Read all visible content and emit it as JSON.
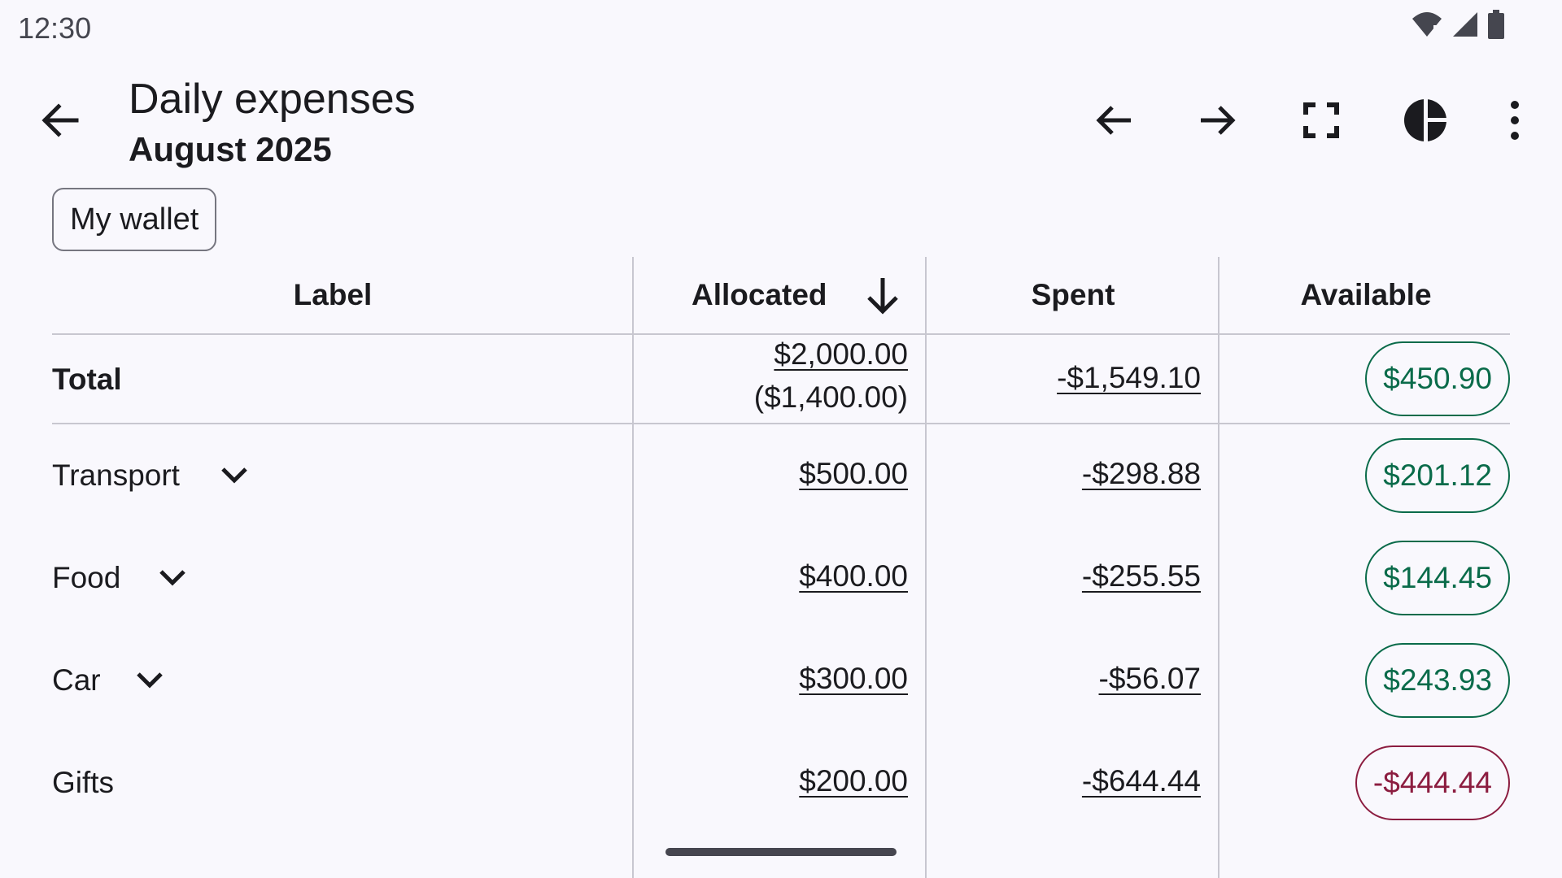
{
  "status_bar": {
    "time": "12:30"
  },
  "app_bar": {
    "title": "Daily expenses",
    "subtitle": "August 2025"
  },
  "wallet_chip": "My wallet",
  "table": {
    "headers": {
      "label": "Label",
      "allocated": "Allocated",
      "spent": "Spent",
      "available": "Available"
    },
    "total": {
      "label": "Total",
      "allocated": "$2,000.00",
      "allocated_sub": "($1,400.00)",
      "spent": "-$1,549.10",
      "available": "$450.90"
    },
    "rows": [
      {
        "label": "Transport",
        "allocated": "$500.00",
        "spent": "-$298.88",
        "available": "$201.12"
      },
      {
        "label": "Food",
        "allocated": "$400.00",
        "spent": "-$255.55",
        "available": "$144.45"
      },
      {
        "label": "Car",
        "allocated": "$300.00",
        "spent": "-$56.07",
        "available": "$243.93"
      },
      {
        "label": "Gifts",
        "allocated": "$200.00",
        "spent": "-$644.44",
        "available": "-$444.44"
      }
    ]
  },
  "colors": {
    "positive": "#0a6b4a",
    "negative": "#8c1d40",
    "divider": "#c8c7d0"
  }
}
